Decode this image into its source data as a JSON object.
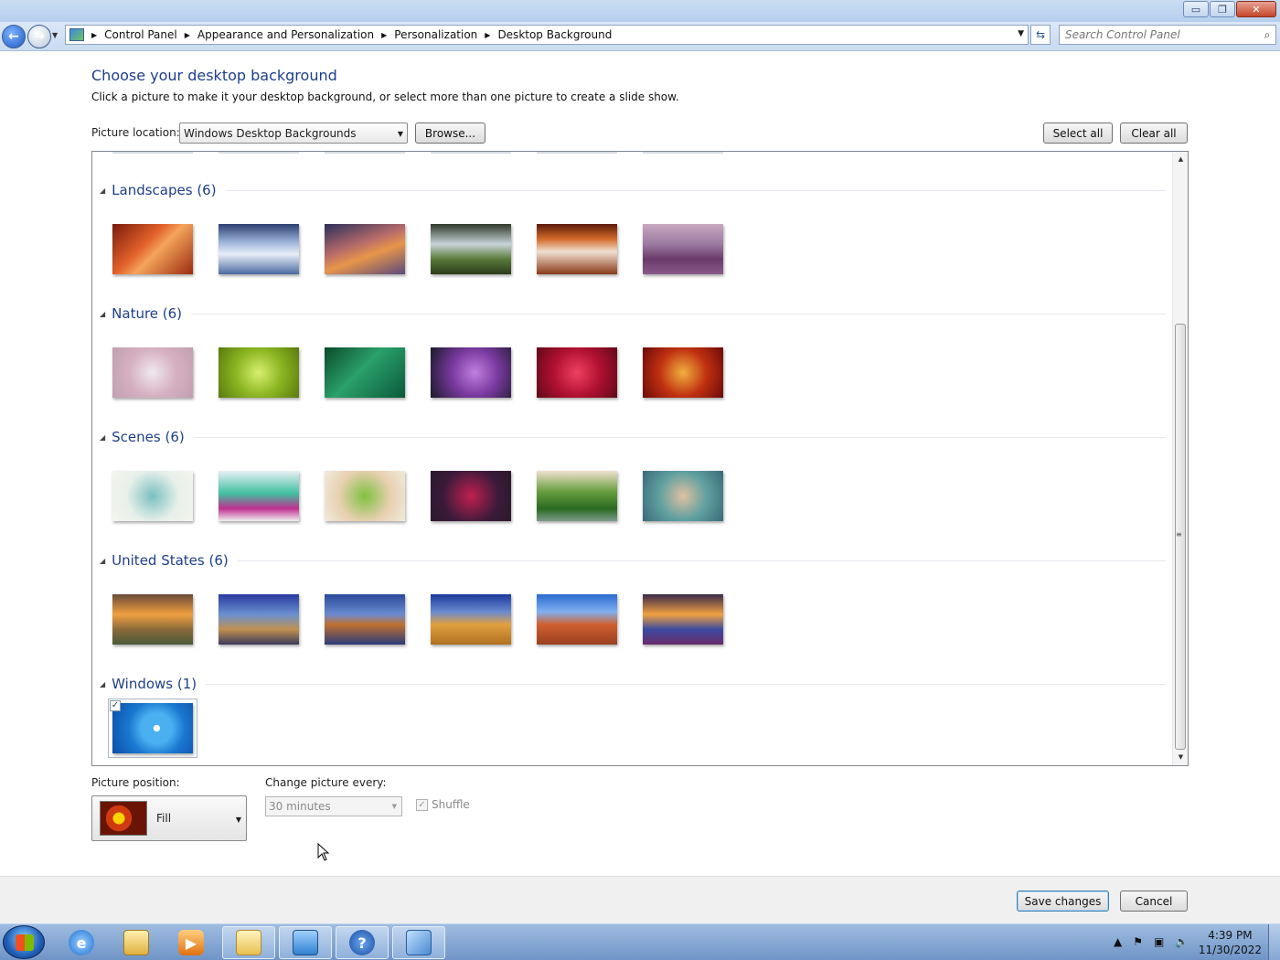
{
  "window": {
    "buttons": {
      "minimize": "▭",
      "restore": "❐",
      "close": "✕"
    }
  },
  "address": {
    "breadcrumbs": [
      "Control Panel",
      "Appearance and Personalization",
      "Personalization",
      "Desktop Background"
    ],
    "search_placeholder": "Search Control Panel"
  },
  "page": {
    "heading": "Choose your desktop background",
    "subheading": "Click a picture to make it your desktop background, or select more than one picture to create a slide show.",
    "location_label": "Picture location:",
    "location_value": "Windows Desktop Backgrounds",
    "browse_label": "Browse...",
    "select_all_label": "Select all",
    "clear_all_label": "Clear all"
  },
  "groups": [
    {
      "title": "Landscapes (6)",
      "thumbs": [
        "linear-gradient(135deg,#7a1a0a,#e2612a 40%,#f4a45a 55%,#9a2a10)",
        "linear-gradient(180deg,#2b3f6f,#9ab0d8 35%,#e8eef7 60%,#4a6aa0)",
        "linear-gradient(160deg,#2a2f5a,#b46a6a 40%,#e8954a 60%,#5a4a7a)",
        "linear-gradient(180deg,#2e3a2a,#c8d4d8 40%,#5a7a3a 70%,#2a3a1a)",
        "linear-gradient(180deg,#5a1a0a,#d46a2a 30%,#f0e0d0 55%,#8a3a1a)",
        "linear-gradient(180deg,#c8a8c0,#9a7aa0 40%,#6a3a6a 70%,#8a5a8a)"
      ]
    },
    {
      "title": "Nature (6)",
      "thumbs": [
        "radial-gradient(circle at 50% 50%,#f0e8ee,#d6b0c0 50%,#c0a0b0)",
        "radial-gradient(circle at 50% 50%,#d8f070,#8ab420 50%,#5a7a10)",
        "linear-gradient(135deg,#0a4a2a,#2aa06a 45%,#0a5a3a)",
        "radial-gradient(circle at 55% 50%,#c080e0,#7a3aa0 45%,#1a1a2a)",
        "radial-gradient(circle at 50% 50%,#f04060,#b01030 50%,#600818)",
        "radial-gradient(circle at 50% 50%,#f0b040,#c03010 50%,#6a0a0a)"
      ]
    },
    {
      "title": "Scenes (6)",
      "thumbs": [
        "radial-gradient(circle at 50% 50%,#7ac0c0,#e8f0ea 55%,#f4f4ee)",
        "linear-gradient(180deg,#e8f0f4,#40c0a0 45%,#c03090 75%,#f0f0f0)",
        "radial-gradient(circle at 50% 50%,#80c040,#e8d0b0 55%,#f0eade)",
        "radial-gradient(circle at 50% 50%,#c02050,#3a1a3a 60%,#2a1a2a)",
        "linear-gradient(180deg,#f0e0d0,#6aa040 40%,#2a6a20 75%,#7a9a8a)",
        "radial-gradient(circle at 50% 50%,#e0c0a0,#60a0a0 50%,#3a6a7a)"
      ]
    },
    {
      "title": "United States (6)",
      "thumbs": [
        "linear-gradient(180deg,#6a4a3a,#f0a040 40%,#8a6a3a 70%,#4a5a3a)",
        "linear-gradient(180deg,#2a3aa0,#6a90d0 40%,#c09050 70%,#3a3a5a)",
        "linear-gradient(180deg,#2a4a9a,#6a8ad0 40%,#c07030 60%,#2a3a7a)",
        "linear-gradient(180deg,#1a3a9a,#6a8ad0 35%,#e0a040 60%,#b07020)",
        "linear-gradient(180deg,#2a6ad0,#80b0f0 35%,#d06030 60%,#9a4020)",
        "linear-gradient(180deg,#3a2a4a,#f0a040 40%,#3a4aa0 70%,#6a2a6a)"
      ]
    },
    {
      "title": "Windows (1)",
      "thumbs": [
        "radial-gradient(circle at 55% 50%,#ffffff 0 6%,#4ab0f0 7% 30%,#1a78d0 55%,#0a4ea8)"
      ]
    }
  ],
  "bottom": {
    "position_label": "Picture position:",
    "position_value": "Fill",
    "change_label": "Change picture every:",
    "interval_value": "30 minutes",
    "shuffle_label": "Shuffle",
    "save_label": "Save changes",
    "cancel_label": "Cancel"
  },
  "taskbar": {
    "time": "4:39 PM",
    "date": "11/30/2022"
  }
}
